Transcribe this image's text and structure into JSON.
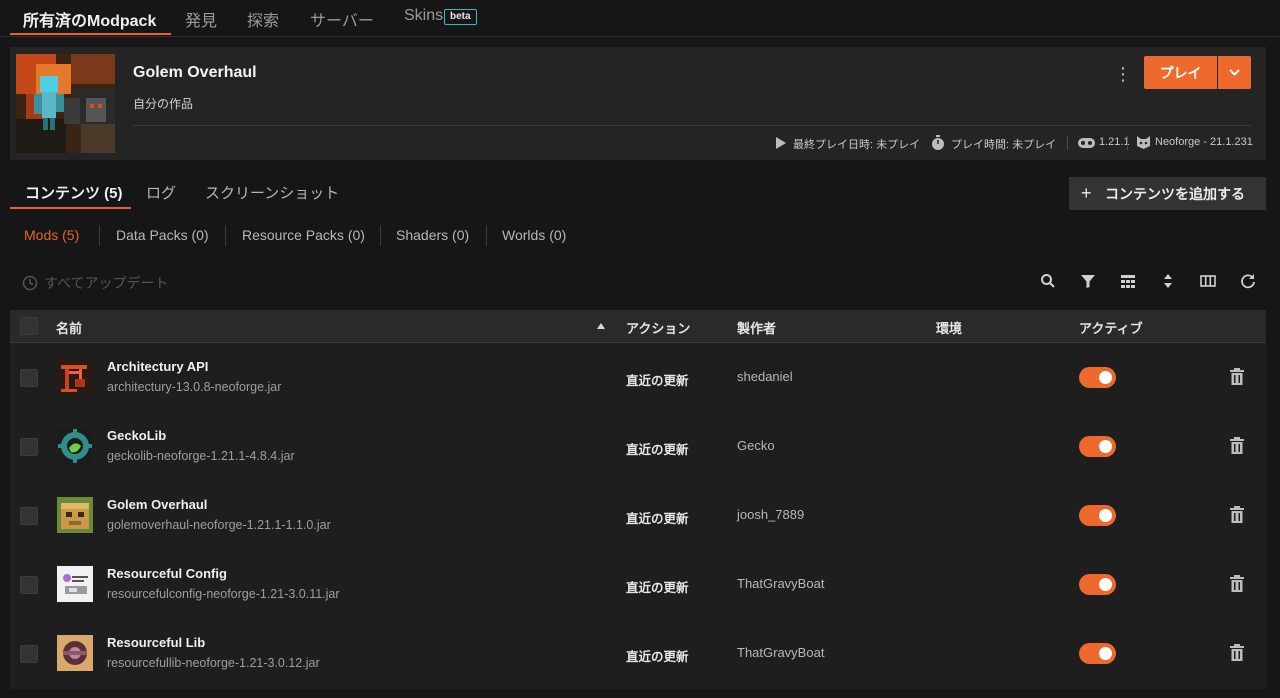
{
  "nav": {
    "tabs": [
      {
        "label": "所有済のModpack"
      },
      {
        "label": "発見"
      },
      {
        "label": "探索"
      },
      {
        "label": "サーバー"
      },
      {
        "label": "Skins"
      }
    ],
    "beta_badge": "beta"
  },
  "pack": {
    "title": "Golem Overhaul",
    "subtitle": "自分の作品",
    "play_label": "プレイ",
    "last_played": "最終プレイ日時: 未プレイ",
    "play_time": "プレイ時間: 未プレイ",
    "mc_version": "1.21.1",
    "loader": "Neoforge - 21.1.231"
  },
  "content_tabs": [
    {
      "label": "コンテンツ (5)"
    },
    {
      "label": "ログ"
    },
    {
      "label": "スクリーンショット"
    }
  ],
  "add_content_label": "コンテンツを追加する",
  "filters": [
    {
      "label": "Mods (5)"
    },
    {
      "label": "Data Packs (0)"
    },
    {
      "label": "Resource Packs (0)"
    },
    {
      "label": "Shaders (0)"
    },
    {
      "label": "Worlds (0)"
    }
  ],
  "update_all_label": "すべてアップデート",
  "table": {
    "headers": {
      "name": "名前",
      "action": "アクション",
      "author": "製作者",
      "environment": "環境",
      "active": "アクティブ"
    },
    "rows": [
      {
        "name": "Architectury API",
        "file": "architectury-13.0.8-neoforge.jar",
        "action": "直近の更新",
        "author": "shedaniel",
        "active": true
      },
      {
        "name": "GeckoLib",
        "file": "geckolib-neoforge-1.21.1-4.8.4.jar",
        "action": "直近の更新",
        "author": "Gecko",
        "active": true
      },
      {
        "name": "Golem Overhaul",
        "file": "golemoverhaul-neoforge-1.21.1-1.1.0.jar",
        "action": "直近の更新",
        "author": "joosh_7889",
        "active": true
      },
      {
        "name": "Resourceful Config",
        "file": "resourcefulconfig-neoforge-1.21-3.0.11.jar",
        "action": "直近の更新",
        "author": "ThatGravyBoat",
        "active": true
      },
      {
        "name": "Resourceful Lib",
        "file": "resourcefullib-neoforge-1.21-3.0.12.jar",
        "action": "直近の更新",
        "author": "ThatGravyBoat",
        "active": true
      }
    ]
  },
  "colors": {
    "accent": "#ee6a2c",
    "background": "#161616",
    "card": "#242424",
    "beta_border": "#3fb5c9"
  }
}
